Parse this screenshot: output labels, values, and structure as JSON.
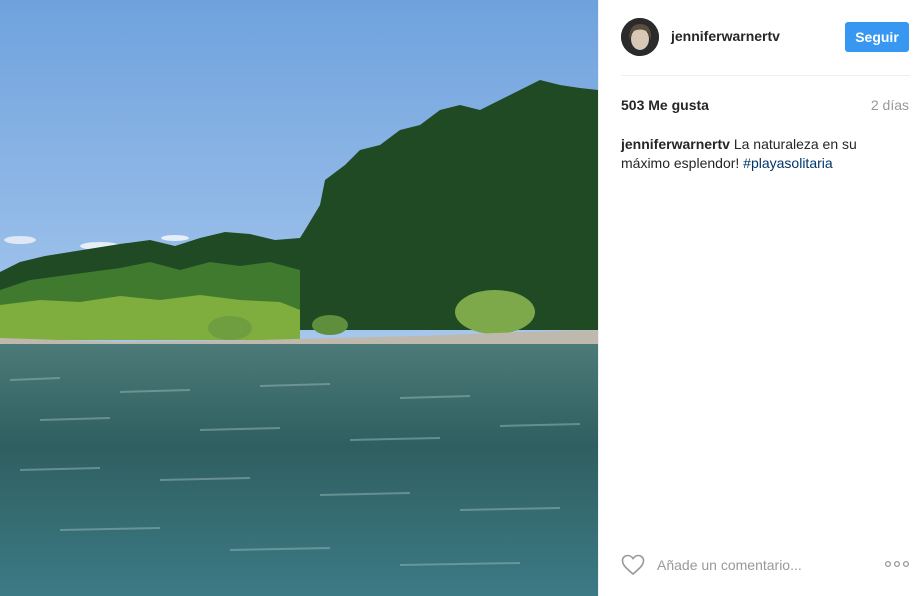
{
  "post": {
    "username": "jenniferwarnertv",
    "follow_label": "Seguir",
    "likes": "503 Me gusta",
    "time_ago": "2 días",
    "caption_user": "jenniferwarnertv",
    "caption_text": " La naturaleza en su máximo esplendor! ",
    "hashtag": "#playasolitaria",
    "comment_placeholder": "Añade un comentario..."
  },
  "icons": {
    "like": "heart-outline-icon",
    "more": "more-options-icon"
  },
  "colors": {
    "accent": "#3897f0",
    "hashtag": "#003569",
    "muted": "#999999"
  }
}
